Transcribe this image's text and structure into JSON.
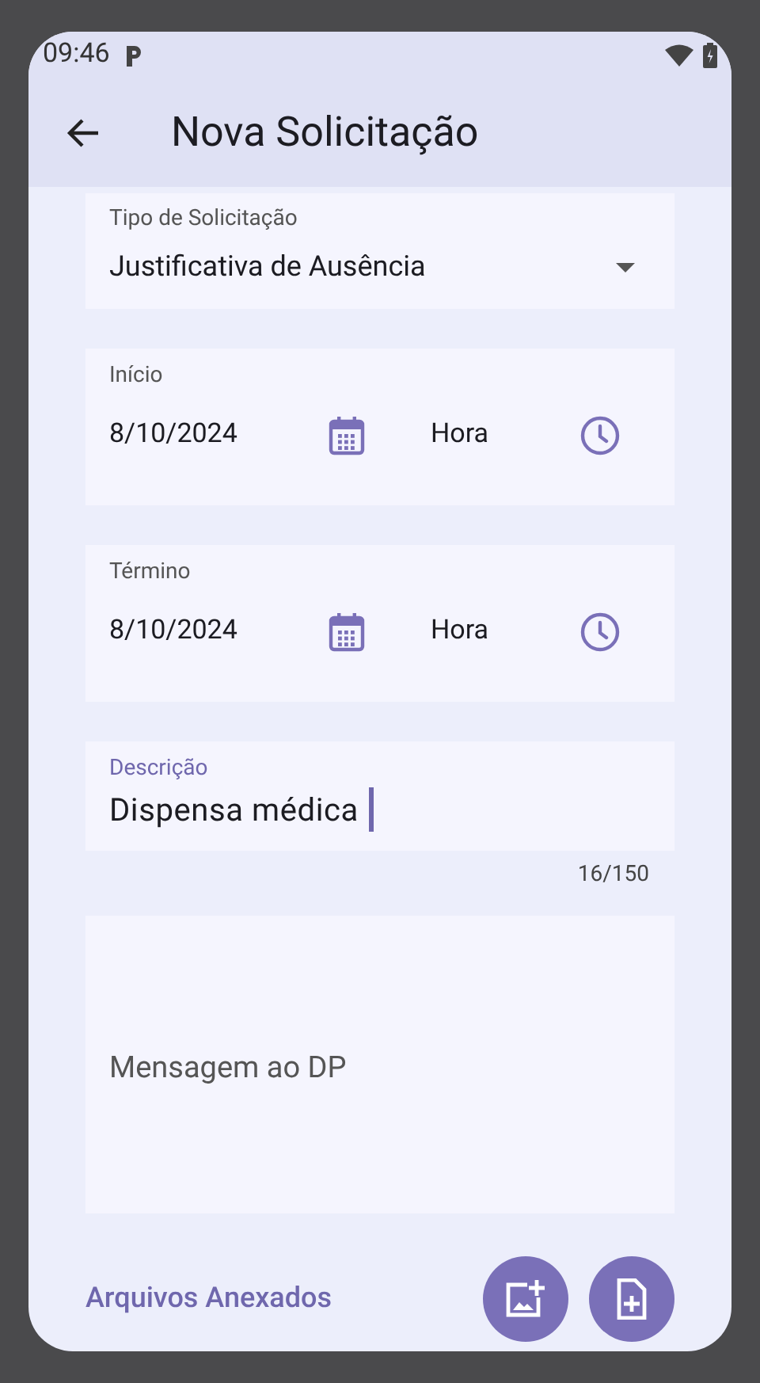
{
  "status_bar": {
    "time": "09:46"
  },
  "app_bar": {
    "title": "Nova Solicitação"
  },
  "type_field": {
    "label": "Tipo de Solicitação",
    "value": "Justificativa de Ausência"
  },
  "date_fields": [
    {
      "label": "Início",
      "date": "8/10/2024",
      "time_placeholder": "Hora"
    },
    {
      "label": "Término",
      "date": "8/10/2024",
      "time_placeholder": "Hora"
    }
  ],
  "description": {
    "label": "Descrição",
    "value": "Dispensa médica",
    "focused": true,
    "counter": "16/150"
  },
  "message": {
    "placeholder": "Mensagem ao DP"
  },
  "attachments": {
    "title": "Arquivos Anexados"
  }
}
